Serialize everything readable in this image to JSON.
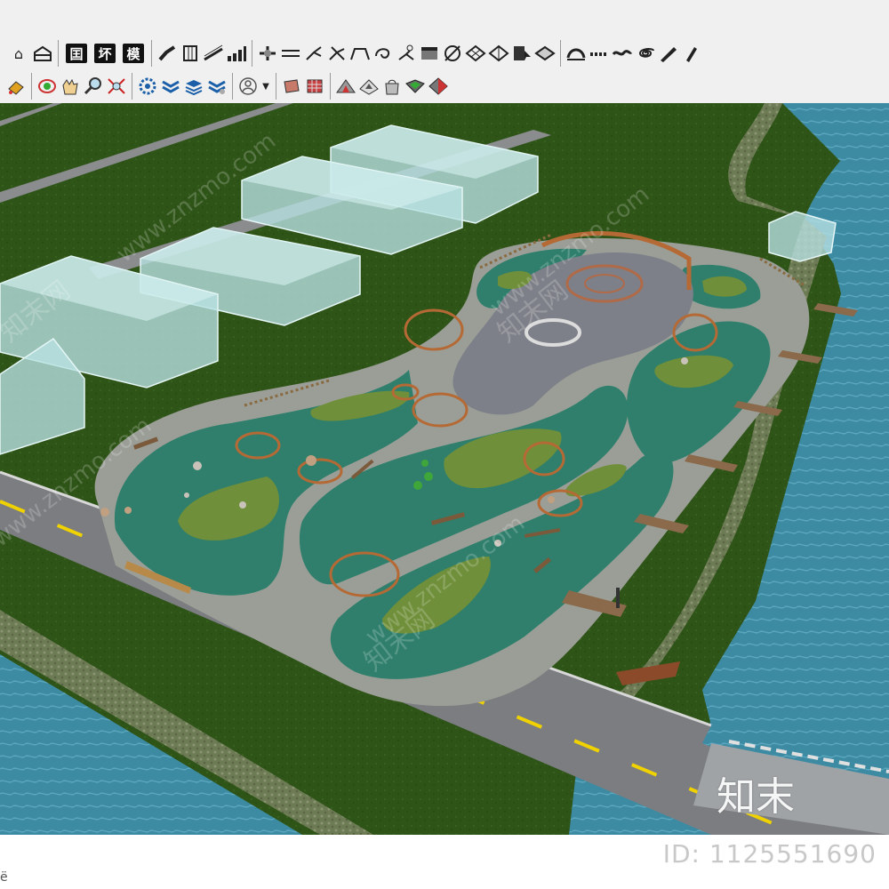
{
  "toolbar_row1": {
    "chinese_buttons": [
      "囯",
      "坏",
      "模"
    ],
    "icons": [
      "home-icon",
      "warehouse-icon",
      "stair-icon",
      "column-icon",
      "ramp-icon",
      "bar-chart-icon",
      "road-junction-icon",
      "double-line-icon",
      "branch-arrow-icon",
      "spread-arrow-icon",
      "arch-bridge-icon",
      "curve-arrow-icon",
      "tree-branch-icon",
      "box-face-icon",
      "slash-circle-icon",
      "grid-diamond-icon",
      "split-diamond-icon",
      "book-cursor-icon",
      "layer-swap-icon",
      "arc-icon",
      "dotted-line-icon",
      "wave-line-icon",
      "spiral-icon",
      "pen-icon",
      "pencil-icon"
    ]
  },
  "toolbar_row2": {
    "icons": [
      "paint-bucket-icon",
      "orbit-icon",
      "pan-hand-icon",
      "zoom-icon",
      "zoom-extents-icon",
      "gear-settings-icon",
      "wave-settings-icon",
      "layer-settings-icon",
      "pipe-settings-icon",
      "user-circle-icon",
      "dropdown-arrow-icon",
      "material-box-icon",
      "grid-material-icon",
      "terrain-icon",
      "terrain-edit-icon",
      "bag-icon",
      "map-texture-icon",
      "sphere-texture-icon"
    ]
  },
  "viewport": {
    "watermark_text": "www.znzmo.com",
    "watermark_cn": "知末网"
  },
  "branding": {
    "logo_text": "知末",
    "id_text": "ID: 1125551690"
  },
  "statusbar": {
    "glyph": "ё"
  },
  "colors": {
    "grass": "#2f5418",
    "water": "#3d8aa3",
    "plaza_teal": "#2f7f6c",
    "path": "#9a9e96",
    "road": "#7b7d80",
    "building": "#b9e2e3"
  }
}
